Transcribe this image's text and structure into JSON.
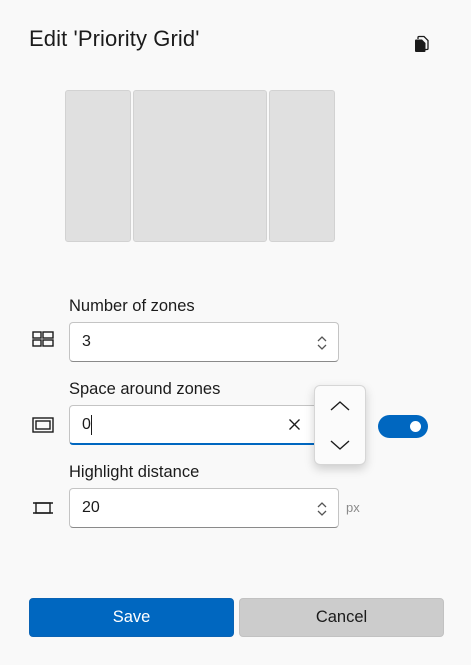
{
  "dialog": {
    "title": "Edit 'Priority Grid'",
    "copy_icon": "copy-icon"
  },
  "preview": {
    "zone_count": 3
  },
  "fields": {
    "zones": {
      "label": "Number of zones",
      "value": "3",
      "icon": "grid-zones-icon"
    },
    "space": {
      "label": "Space around zones",
      "value": "0",
      "icon": "space-around-icon",
      "toggle_on": true
    },
    "highlight": {
      "label": "Highlight distance",
      "value": "20",
      "unit": "px",
      "icon": "highlight-distance-icon"
    }
  },
  "buttons": {
    "save": "Save",
    "cancel": "Cancel"
  },
  "colors": {
    "accent": "#0067c0",
    "zone_fill": "#e0e0e0",
    "background": "#f9f9f9"
  }
}
